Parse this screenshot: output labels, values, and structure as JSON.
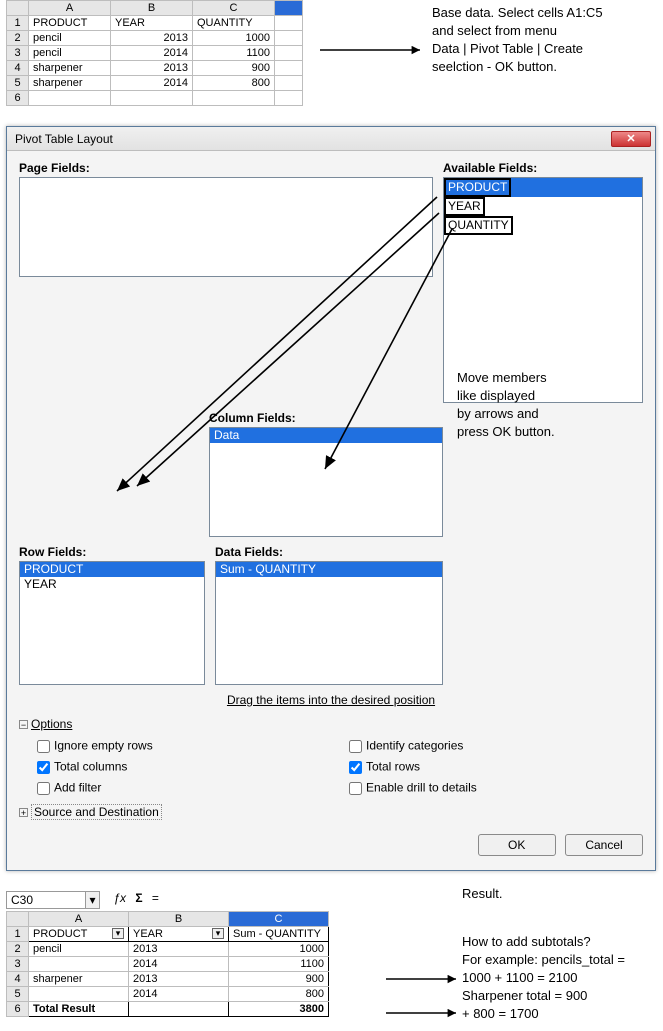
{
  "sheet1": {
    "cols": [
      "A",
      "B",
      "C"
    ],
    "headers": [
      "PRODUCT",
      "YEAR",
      "QUANTITY"
    ],
    "rows": [
      {
        "n": "2",
        "a": "pencil",
        "b": "2013",
        "c": "1000"
      },
      {
        "n": "3",
        "a": "pencil",
        "b": "2014",
        "c": "1100"
      },
      {
        "n": "4",
        "a": "sharpener",
        "b": "2013",
        "c": "900"
      },
      {
        "n": "5",
        "a": "sharpener",
        "b": "2014",
        "c": "800"
      },
      {
        "n": "6",
        "a": "",
        "b": "",
        "c": ""
      }
    ]
  },
  "annot1": {
    "l1": "Base data. Select cells A1:C5",
    "l2": "and select from menu",
    "l3": "Data | Pivot Table | Create",
    "l4": "seelction -  OK button."
  },
  "dialog": {
    "title": "Pivot Table Layout",
    "labels": {
      "page": "Page Fields:",
      "avail": "Available Fields:",
      "column": "Column Fields:",
      "row": "Row Fields:",
      "data": "Data Fields:"
    },
    "avail": [
      "PRODUCT",
      "YEAR",
      "QUANTITY"
    ],
    "column_fields": [
      "Data"
    ],
    "row_fields": [
      "PRODUCT",
      "YEAR"
    ],
    "data_fields": [
      "Sum - QUANTITY"
    ],
    "drag_hint": "Drag the items into the desired position",
    "options_head": "Options",
    "opts": {
      "ignore": "Ignore empty rows",
      "totalcols": "Total columns",
      "addfilter": "Add filter",
      "identify": "Identify categories",
      "totalrows": "Total rows",
      "drill": "Enable drill to details"
    },
    "srcdest": "Source and Destination",
    "ok": "OK",
    "cancel": "Cancel"
  },
  "annot2": {
    "l1": "Move members",
    "l2": "like displayed",
    "l3": "by arrows and",
    "l4": "press OK button."
  },
  "result": {
    "cellref": "C30",
    "fx": "ƒx",
    "sigma": "Σ",
    "eq": "=",
    "cols": [
      "A",
      "B",
      "C"
    ],
    "header_row": {
      "n": "1",
      "a": "PRODUCT",
      "b": "YEAR",
      "c": "Sum - QUANTITY"
    },
    "rows": [
      {
        "n": "2",
        "a": "pencil",
        "b": "2013",
        "c": "1000"
      },
      {
        "n": "3",
        "a": "",
        "b": "2014",
        "c": "1100"
      },
      {
        "n": "4",
        "a": "sharpener",
        "b": "2013",
        "c": "900"
      },
      {
        "n": "5",
        "a": "",
        "b": "2014",
        "c": "800"
      }
    ],
    "total_row": {
      "n": "6",
      "a": "Total Result",
      "b": "",
      "c": "3800"
    }
  },
  "annot3": {
    "l1": "Result."
  },
  "annot4": {
    "l1": "How to add subtotals?",
    "l2": "For example: pencils_total =",
    "l3": "1000 + 1100 = 2100",
    "l4": "Sharpener total = 900",
    "l5": " + 800 = 1700"
  }
}
